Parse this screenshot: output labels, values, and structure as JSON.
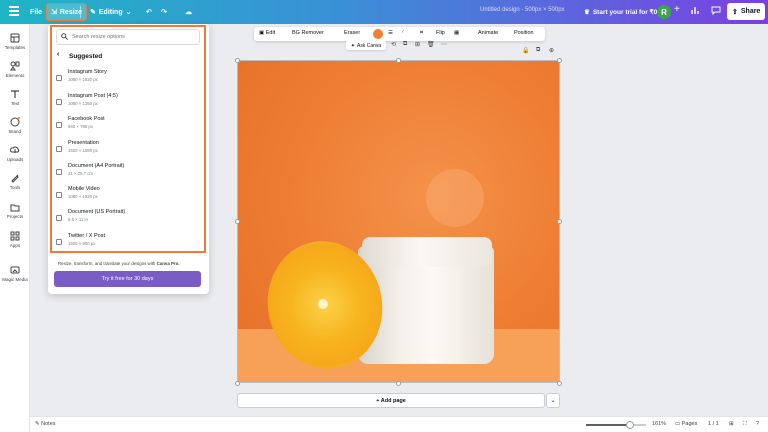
{
  "topbar": {
    "file_label": "File",
    "resize_label": "Resize",
    "editing_label": "Editing",
    "doc_title": "Untitled design - 500px × 500px",
    "trial_label": "Start your trial for ₹0",
    "avatar_letter": "R",
    "share_label": "Share"
  },
  "rail": {
    "items": [
      {
        "label": "Templates",
        "icon": "templates-icon"
      },
      {
        "label": "Elements",
        "icon": "elements-icon"
      },
      {
        "label": "Text",
        "icon": "text-icon"
      },
      {
        "label": "Brand",
        "icon": "brand-icon"
      },
      {
        "label": "Uploads",
        "icon": "uploads-icon"
      },
      {
        "label": "Tools",
        "icon": "tools-icon"
      },
      {
        "label": "Projects",
        "icon": "projects-icon"
      },
      {
        "label": "Apps",
        "icon": "apps-icon"
      },
      {
        "label": "Magic Media",
        "icon": "magic-media-icon"
      }
    ]
  },
  "resize_panel": {
    "search_placeholder": "Search resize options",
    "section_title": "Suggested",
    "options": [
      {
        "name": "Instagram Story",
        "size": "1080 × 1920 px"
      },
      {
        "name": "Instagram Post (4:5)",
        "size": "1080 × 1350 px"
      },
      {
        "name": "Facebook Post",
        "size": "940 × 788 px"
      },
      {
        "name": "Presentation",
        "size": "1920 × 1080 px"
      },
      {
        "name": "Document (A4 Portrait)",
        "size": "21 × 29.7 cm"
      },
      {
        "name": "Mobile Video",
        "size": "1080 × 1920 px"
      },
      {
        "name": "Document (US Portrait)",
        "size": "8.5 × 11 in"
      },
      {
        "name": "Twitter / X Post",
        "size": "1600 × 900 px"
      }
    ],
    "promo_text": "Resize, transform, and translate your designs with",
    "promo_brand": "Canva Pro.",
    "cta_label": "Try it free for 30 days"
  },
  "context_toolbar": {
    "edit_label": "Edit",
    "bg_remover_label": "BG Remover",
    "eraser_label": "Eraser",
    "flip_label": "Flip",
    "animate_label": "Animate",
    "position_label": "Position",
    "ask_canva_label": "Ask Canva"
  },
  "canvas": {
    "add_page_label": "+ Add page"
  },
  "bottombar": {
    "notes_label": "Notes",
    "zoom_level": "161%",
    "pages_label": "Pages",
    "page_count": "1 / 1"
  },
  "colors": {
    "accent_purple": "#7a5cc6",
    "highlight_orange": "#f07a3a",
    "canvas_background": "#f0843a"
  }
}
